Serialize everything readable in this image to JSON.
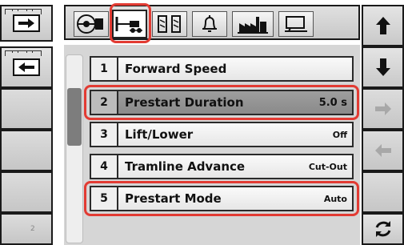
{
  "tabs": [
    {
      "name": "tractor-tab"
    },
    {
      "name": "seeder-tab"
    },
    {
      "name": "tramline-tab"
    },
    {
      "name": "alarm-tab"
    },
    {
      "name": "factory-tab"
    },
    {
      "name": "display-tab"
    }
  ],
  "rows": [
    {
      "num": "1",
      "label": "Forward Speed",
      "value": ""
    },
    {
      "num": "2",
      "label": "Prestart Duration",
      "value": "5.0 s"
    },
    {
      "num": "3",
      "label": "Lift/Lower",
      "value": "Off"
    },
    {
      "num": "4",
      "label": "Tramline Advance",
      "value": "Cut-Out"
    },
    {
      "num": "5",
      "label": "Prestart Mode",
      "value": "Auto"
    }
  ],
  "page_number": "2",
  "colors": {
    "highlight": "#e23b33",
    "selected_row": "#8f8f8f"
  }
}
